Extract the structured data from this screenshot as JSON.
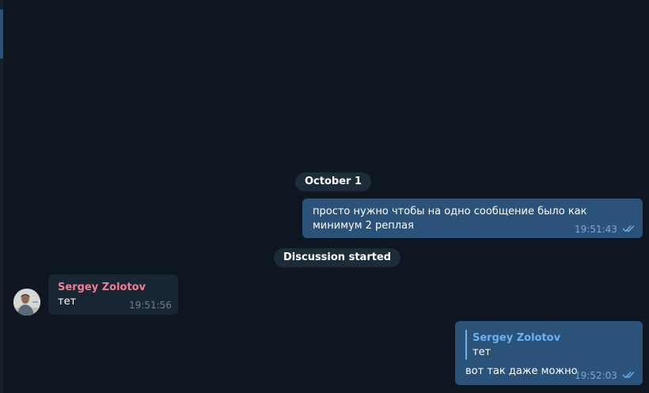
{
  "chat": {
    "date_separator": "October 1",
    "service_message": "Discussion started",
    "messages": [
      {
        "direction": "out",
        "text": "просто нужно чтобы на одно сообщение было как минимум 2 реплая",
        "time": "19:51:43",
        "status": "read-double-check-icon"
      },
      {
        "direction": "in",
        "sender": "Sergey Zolotov",
        "text": "тет",
        "time": "19:51:56"
      },
      {
        "direction": "out",
        "reply_to": {
          "sender": "Sergey Zolotov",
          "text": "тет"
        },
        "text": "вот так даже можно",
        "time": "19:52:03",
        "status": "read-double-check-icon"
      }
    ]
  },
  "colors": {
    "background": "#0e1621",
    "outgoing_bubble": "#2b5278",
    "incoming_bubble": "#182533",
    "sender_name": "#f37e8f",
    "reply_accent": "#6ab3f3",
    "meta_outgoing": "#7da8d3",
    "meta_incoming": "#6d7f8f"
  }
}
